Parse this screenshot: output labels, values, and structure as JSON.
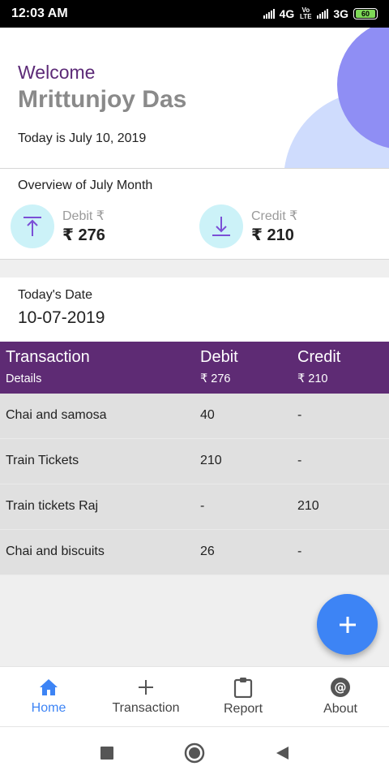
{
  "status_bar": {
    "time": "12:03 AM",
    "network1": "4G",
    "volte": "Vo LTE",
    "network2": "3G",
    "battery": "60"
  },
  "header": {
    "welcome": "Welcome",
    "user_name": "Mrittunjoy Das",
    "today_text": "Today is July 10, 2019"
  },
  "overview": {
    "title": "Overview of July Month",
    "debit": {
      "label": "Debit ₹",
      "value": "₹ 276",
      "icon": "upload-arrow-icon"
    },
    "credit": {
      "label": "Credit ₹",
      "value": "₹ 210",
      "icon": "download-arrow-icon"
    }
  },
  "today_date": {
    "label": "Today's Date",
    "value": "10-07-2019"
  },
  "table": {
    "header": {
      "col1_title": "Transaction",
      "col1_sub": "Details",
      "col2_title": "Debit",
      "col2_sub": "₹ 276",
      "col3_title": "Credit",
      "col3_sub": "₹ 210"
    },
    "rows": [
      {
        "details": "Chai and samosa",
        "debit": "40",
        "credit": "-"
      },
      {
        "details": "Train Tickets",
        "debit": "210",
        "credit": "-"
      },
      {
        "details": "Train tickets Raj",
        "debit": "-",
        "credit": "210"
      },
      {
        "details": "Chai and biscuits",
        "debit": "26",
        "credit": "-"
      }
    ]
  },
  "fab": {
    "icon": "plus-icon"
  },
  "bottom_nav": [
    {
      "label": "Home",
      "icon": "home-icon",
      "active": true
    },
    {
      "label": "Transaction",
      "icon": "plus-icon",
      "active": false
    },
    {
      "label": "Report",
      "icon": "clipboard-icon",
      "active": false
    },
    {
      "label": "About",
      "icon": "at-sign-icon",
      "active": false
    }
  ],
  "colors": {
    "primary": "#5e2b74",
    "accent": "#3d84f5",
    "icon_bg": "#ccf2f8",
    "icon_fg": "#7b4fd6",
    "circle_dark": "#8f8ef4",
    "circle_light": "#cfdcfd"
  }
}
